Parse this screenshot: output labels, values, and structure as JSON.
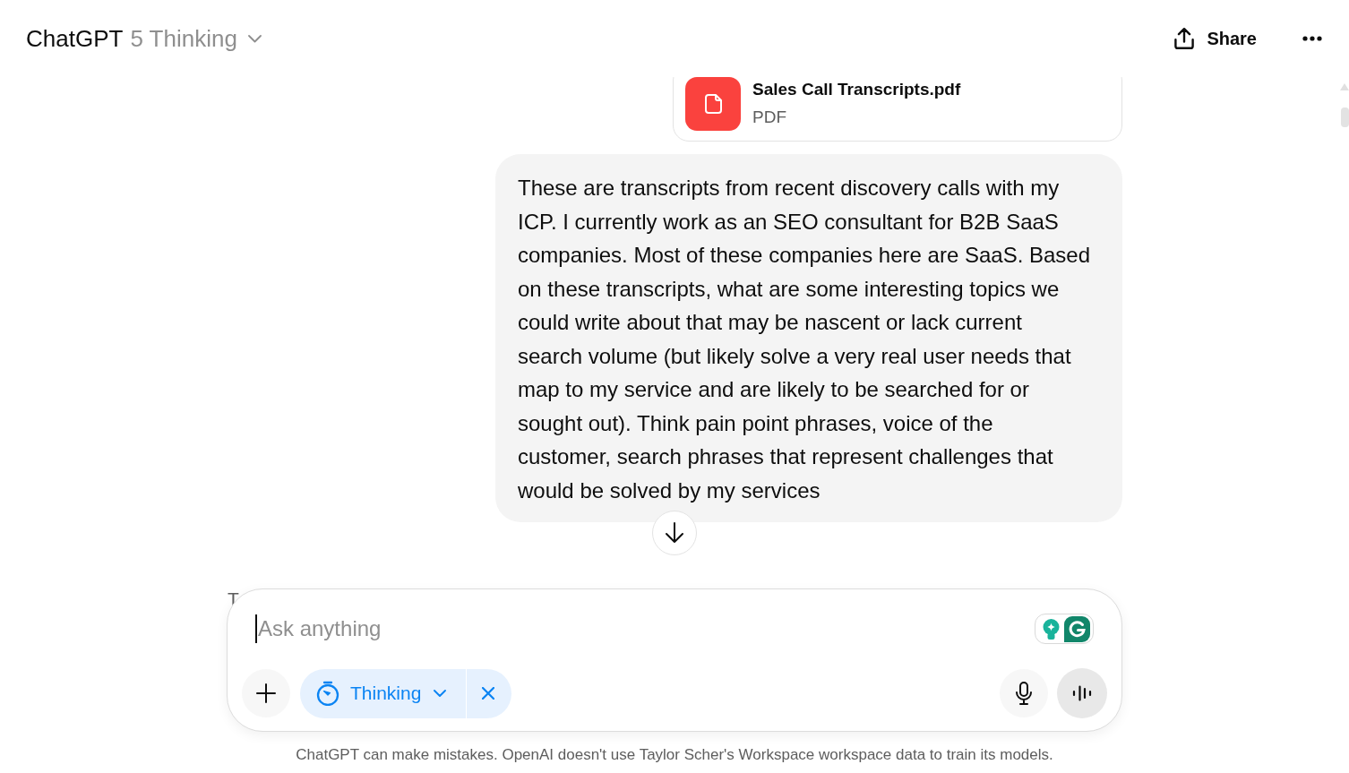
{
  "header": {
    "title": "ChatGPT",
    "model": "5 Thinking",
    "share_label": "Share"
  },
  "attachment": {
    "file_name": "Sales Call Transcripts.pdf",
    "file_type": "PDF"
  },
  "message": {
    "text": "These are transcripts from recent discovery calls with my ICP. I currently work as an SEO consultant for B2B SaaS companies. Most of these companies here are SaaS. Based on these transcripts, what are some interesting topics we could write about that may be nascent or lack current search volume (but likely solve a very real user needs that map to my service and are likely to be searched for or sought out). Think pain point phrases, voice of the customer, search phrases that represent challenges that would be solved by my services"
  },
  "covered_text": "T",
  "composer": {
    "placeholder": "Ask anything",
    "mode": {
      "label": "Thinking"
    }
  },
  "disclaimer": "ChatGPT can make mistakes. OpenAI doesn't use Taylor Scher's Workspace workspace data to train its models."
}
